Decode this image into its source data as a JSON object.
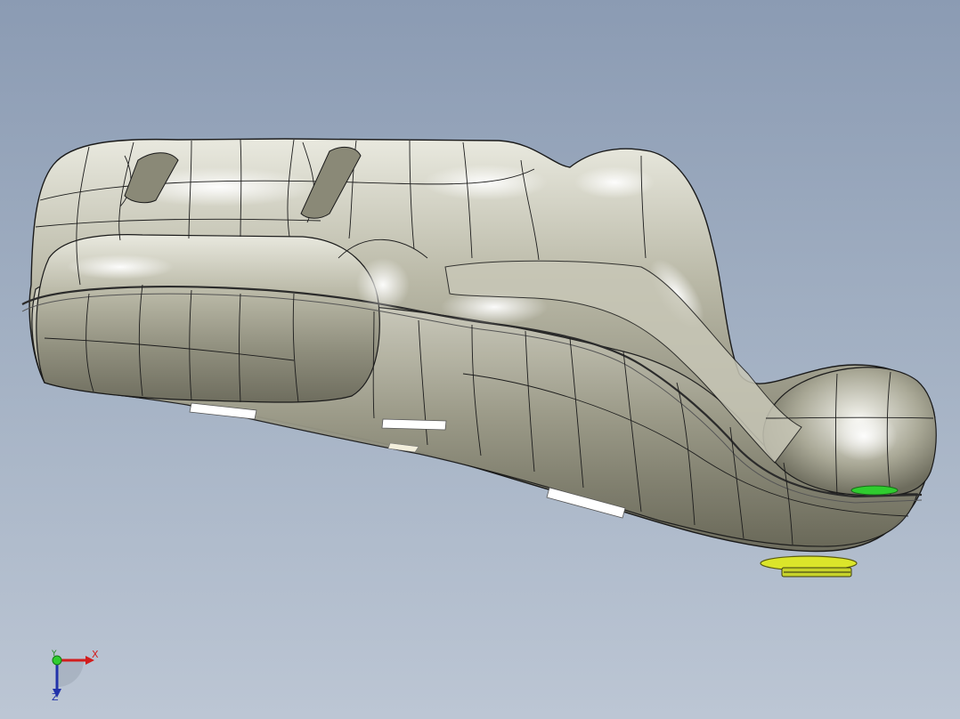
{
  "viewport": {
    "name": "3d-model-viewport",
    "background_top": "#8b9bb3",
    "background_bottom": "#bcc6d4",
    "model_color": "#b4b39f",
    "edge_color": "#1a1a1a",
    "accent_green": "#2fcc2f",
    "accent_yellow": "#dbe52a"
  },
  "triad": {
    "x_label": "X",
    "y_label": "Y",
    "z_label": "Z",
    "x_color": "#d21d1d",
    "y_color": "#1f8a1f",
    "z_color": "#2233aa"
  }
}
